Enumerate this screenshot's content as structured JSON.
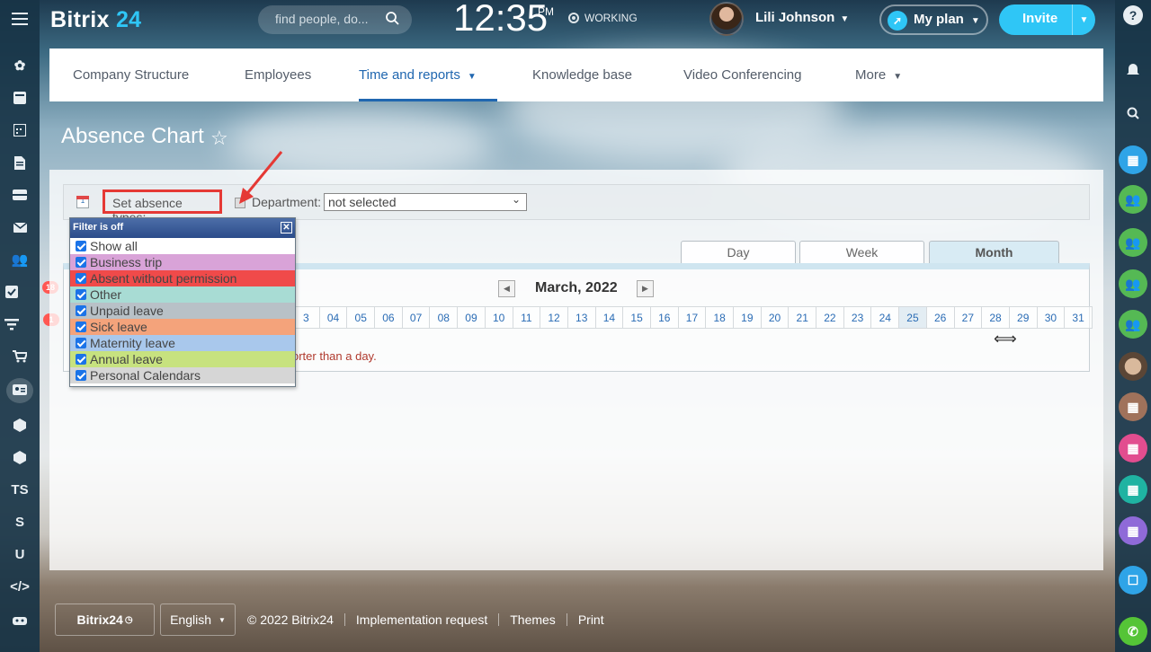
{
  "header": {
    "logo_text": "Bitrix",
    "logo_num": "24",
    "search_placeholder": "find people, do...",
    "time": "12:35",
    "ampm": "PM",
    "status": "WORKING",
    "user_name": "Lili Johnson",
    "my_plan_label": "My plan",
    "invite_label": "Invite"
  },
  "nav": {
    "items": [
      {
        "label": "Company Structure"
      },
      {
        "label": "Employees"
      },
      {
        "label": "Time and reports"
      },
      {
        "label": "Knowledge base"
      },
      {
        "label": "Video Conferencing"
      },
      {
        "label": "More"
      }
    ],
    "active_index": 2
  },
  "page": {
    "title": "Absence Chart"
  },
  "toolbar": {
    "set_absence_types_label": "Set absence types:",
    "calendar_icon_text": "1",
    "department_label": "Department:",
    "department_value": "not selected"
  },
  "views": {
    "tabs": [
      {
        "label": "Day"
      },
      {
        "label": "Week"
      },
      {
        "label": "Month"
      }
    ],
    "active": "Month"
  },
  "calendar": {
    "month_title": "March, 2022",
    "days": [
      "3",
      "04",
      "05",
      "06",
      "07",
      "08",
      "09",
      "10",
      "11",
      "12",
      "13",
      "14",
      "15",
      "16",
      "17",
      "18",
      "19",
      "20",
      "21",
      "22",
      "23",
      "24",
      "25",
      "26",
      "27",
      "28",
      "29",
      "30",
      "31"
    ],
    "highlighted_day": "25",
    "notice_fragment": "orter than a day."
  },
  "filter": {
    "title": "Filter is off",
    "items": [
      {
        "label": "Show all",
        "color": "#ffffff"
      },
      {
        "label": "Business trip",
        "color": "#d9a3d8"
      },
      {
        "label": "Absent without permission",
        "color": "#f04a4a"
      },
      {
        "label": "Other",
        "color": "#a8dcd4"
      },
      {
        "label": "Unpaid leave",
        "color": "#b8c1c7"
      },
      {
        "label": "Sick leave",
        "color": "#f4a37b"
      },
      {
        "label": "Maternity leave",
        "color": "#a9c8ec"
      },
      {
        "label": "Annual leave",
        "color": "#c7e27f"
      },
      {
        "label": "Personal Calendars",
        "color": "#d6d6d6"
      }
    ]
  },
  "left_sidebar": {
    "items": [
      {
        "icon": "menu-icon"
      },
      {
        "icon": "feed-icon"
      },
      {
        "icon": "tasks-board-icon"
      },
      {
        "icon": "calendar-icon"
      },
      {
        "icon": "documents-icon"
      },
      {
        "icon": "drive-icon"
      },
      {
        "icon": "mail-icon"
      },
      {
        "icon": "workgroups-icon"
      },
      {
        "icon": "tasks-icon",
        "badge": "18"
      },
      {
        "icon": "crm-icon",
        "badge": "1"
      },
      {
        "icon": "store-icon"
      },
      {
        "icon": "employees-icon"
      },
      {
        "icon": "cube-icon"
      },
      {
        "icon": "cube-icon-2"
      },
      {
        "text": "TS"
      },
      {
        "text": "S"
      },
      {
        "text": "U"
      },
      {
        "text": "</>"
      },
      {
        "icon": "robot-icon"
      }
    ]
  },
  "footer": {
    "brand": "Bitrix24",
    "language": "English",
    "copyright": "© 2022 Bitrix24",
    "links": [
      "Implementation request",
      "Themes",
      "Print"
    ]
  }
}
